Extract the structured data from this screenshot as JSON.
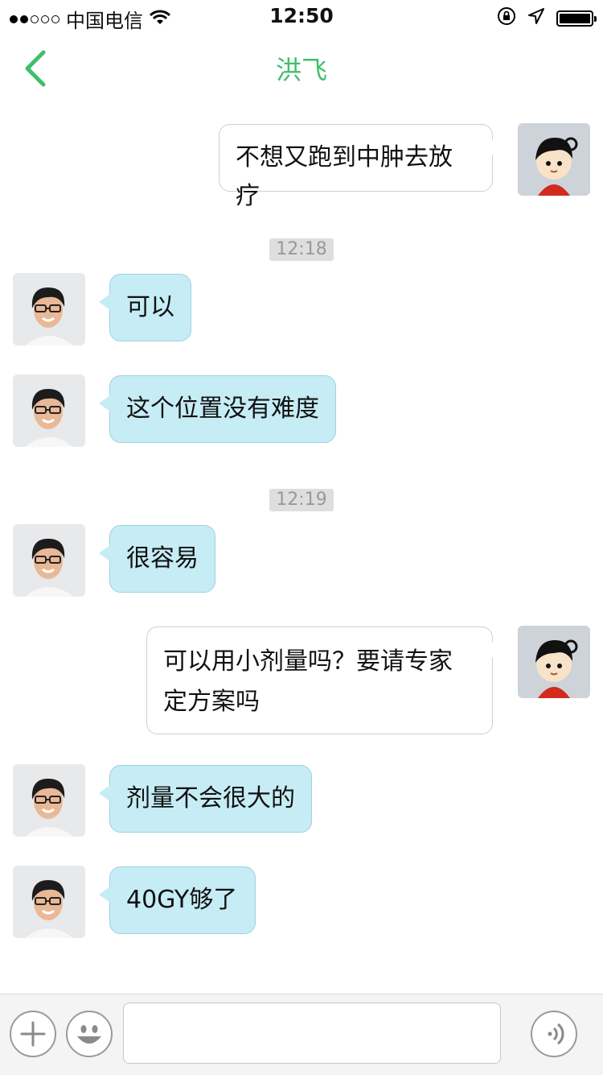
{
  "status_bar": {
    "carrier": "中国电信",
    "time": "12:50",
    "signal_strength": 2,
    "battery_level": 1.0
  },
  "nav": {
    "title": "洪飞",
    "accent_color": "#3fbf6b"
  },
  "messages": [
    {
      "type": "msg",
      "side": "right",
      "text": "不想又跑到中肿去放疗"
    },
    {
      "type": "time",
      "text": "12:18"
    },
    {
      "type": "msg",
      "side": "left",
      "text": "可以"
    },
    {
      "type": "msg",
      "side": "left",
      "text": "这个位置没有难度"
    },
    {
      "type": "time",
      "text": "12:19"
    },
    {
      "type": "msg",
      "side": "left",
      "text": "很容易"
    },
    {
      "type": "msg",
      "side": "right",
      "text": "可以用小剂量吗？要请专家定方案吗"
    },
    {
      "type": "msg",
      "side": "left",
      "text": "剂量不会很大的"
    },
    {
      "type": "msg",
      "side": "left",
      "text": "40GY够了"
    }
  ],
  "input_bar": {
    "text_value": "",
    "icons": [
      "plus-icon",
      "emoji-icon",
      "voice-icon"
    ]
  }
}
